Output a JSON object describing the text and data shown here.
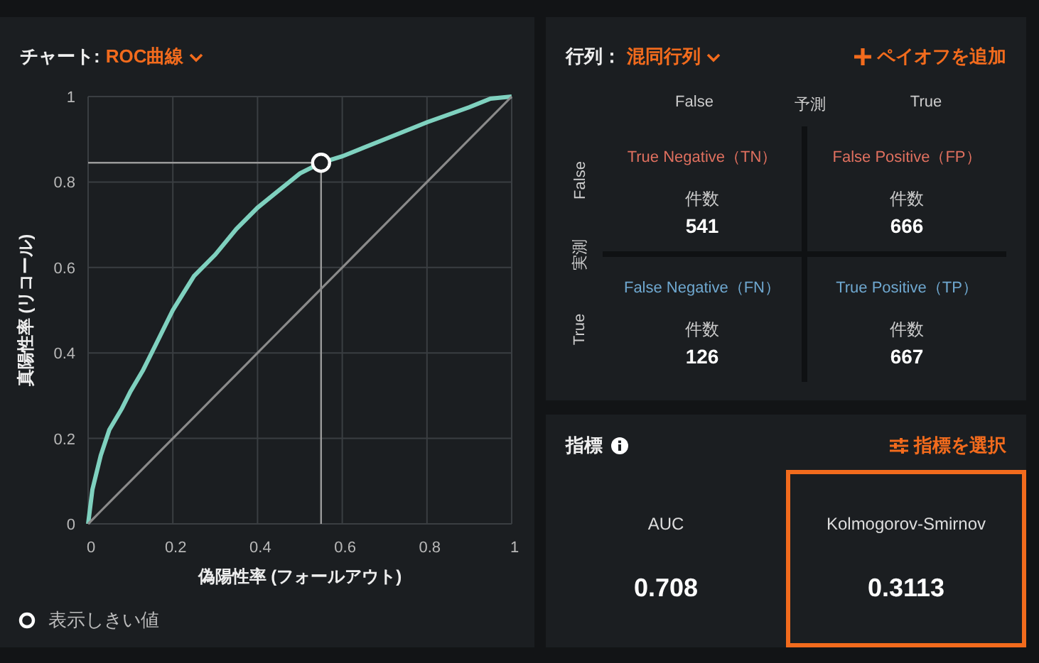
{
  "chart_panel": {
    "label": "チャート:",
    "dropdown": "ROC曲線",
    "chart_data": {
      "type": "line",
      "xlabel": "偽陽性率 (フォールアウト)",
      "ylabel": "真陽性率 (リコール)",
      "x": [
        0,
        0.01,
        0.03,
        0.05,
        0.08,
        0.1,
        0.13,
        0.16,
        0.2,
        0.25,
        0.3,
        0.35,
        0.4,
        0.45,
        0.5,
        0.55,
        0.6,
        0.7,
        0.8,
        0.9,
        0.95,
        1
      ],
      "series": [
        {
          "color": "#7fd1bf",
          "values": [
            0,
            0.08,
            0.16,
            0.22,
            0.27,
            0.31,
            0.36,
            0.42,
            0.5,
            0.58,
            0.63,
            0.69,
            0.74,
            0.78,
            0.82,
            0.845,
            0.86,
            0.9,
            0.94,
            0.975,
            0.995,
            1
          ]
        },
        {
          "color": "#8a8a8a",
          "values": [
            0,
            0.01,
            0.03,
            0.05,
            0.08,
            0.1,
            0.13,
            0.16,
            0.2,
            0.25,
            0.3,
            0.35,
            0.4,
            0.45,
            0.5,
            0.55,
            0.6,
            0.7,
            0.8,
            0.9,
            0.95,
            1
          ]
        }
      ],
      "xlim": [
        0,
        1
      ],
      "ylim": [
        0,
        1
      ],
      "xticks": [
        0,
        0.2,
        0.4,
        0.6,
        0.8,
        1
      ],
      "yticks": [
        0,
        0.2,
        0.4,
        0.6,
        0.8,
        1
      ],
      "grid": true,
      "ref_lines": [
        {
          "axis": "x",
          "value": 0.55
        },
        {
          "axis": "y",
          "value": 0.845
        }
      ]
    },
    "legend": "表示しきい値"
  },
  "matrix_panel": {
    "label": "行列：",
    "dropdown": "混同行列",
    "add_button": "ペイオフを追加",
    "predicted_label": "予測",
    "actual_label": "実測",
    "columns": [
      "False",
      "True"
    ],
    "rows": [
      "False",
      "True"
    ],
    "cells": [
      {
        "title": "True Negative（TN）",
        "color": "#e0705f",
        "count_label": "件数",
        "count": "541"
      },
      {
        "title": "False Positive（FP）",
        "color": "#e0705f",
        "count_label": "件数",
        "count": "666"
      },
      {
        "title": "False Negative（FN）",
        "color": "#6fa8d0",
        "count_label": "件数",
        "count": "126"
      },
      {
        "title": "True Positive（TP）",
        "color": "#6fa8d0",
        "count_label": "件数",
        "count": "667"
      }
    ]
  },
  "metrics_panel": {
    "title": "指標",
    "select_button": "指標を選択",
    "metrics": [
      {
        "name": "AUC",
        "value": "0.708",
        "selected": false
      },
      {
        "name": "Kolmogorov-Smirnov",
        "value": "0.3113",
        "selected": true
      }
    ]
  }
}
